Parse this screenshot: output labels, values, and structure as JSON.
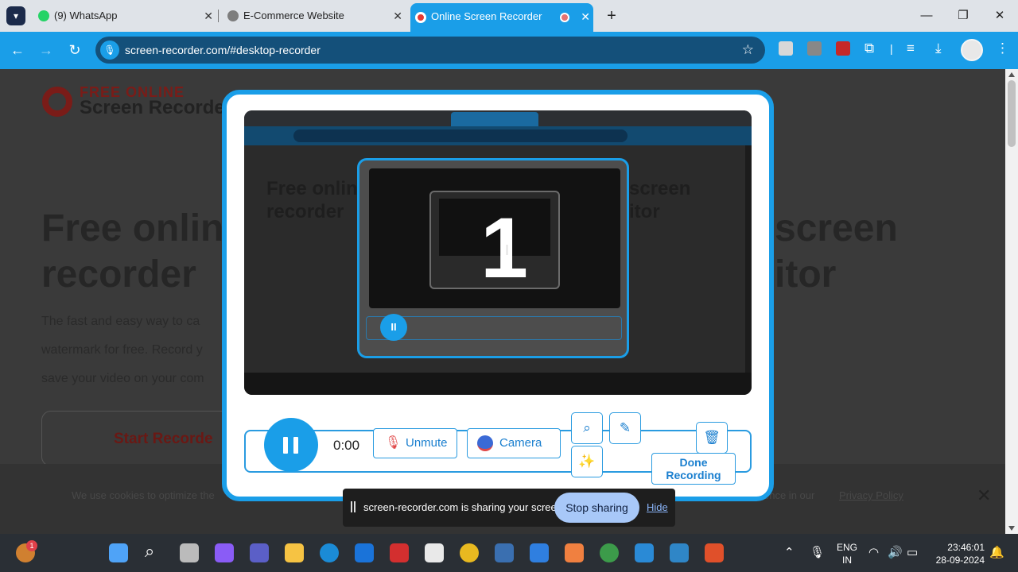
{
  "browser": {
    "tabs": [
      {
        "title": "(9) WhatsApp",
        "favicon_color": "#25d366"
      },
      {
        "title": "E-Commerce Website",
        "favicon_color": "#808080"
      },
      {
        "title": "Online Screen Recorder",
        "favicon_color": "#e53935"
      }
    ],
    "url": "screen-recorder.com/#desktop-recorder"
  },
  "page": {
    "logo_line1": "FREE ONLINE",
    "logo_line2": "Screen Recorder",
    "heading_left_1": "Free onlin",
    "heading_left_2": "recorder",
    "heading_right_1": "screen",
    "heading_right_2": "itor",
    "para_1": "The fast and easy way to ca",
    "para_2": "watermark for free. Record y",
    "para_3": "save your video on your com",
    "start_button": "Start Recorde",
    "cookie_text": "We use cookies to optimize the",
    "cookie_text_right": "ence in our",
    "cookie_link": "Privacy Policy"
  },
  "recorder": {
    "countdown": "1",
    "timer": "0:00",
    "unmute_label": "Unmute",
    "camera_label": "Camera",
    "done_label": "Done Recording"
  },
  "share_bar": {
    "message": "screen-recorder.com is sharing your screen.",
    "stop_label": "Stop sharing",
    "hide_label": "Hide"
  },
  "taskbar": {
    "notification_count": "1",
    "lang_1": "ENG",
    "lang_2": "IN",
    "time": "23:46:01",
    "date": "28-09-2024"
  },
  "colors": {
    "accent": "#1a9ee8",
    "stop_button": "#a8c8f8",
    "logo_red": "#7a1c18"
  }
}
